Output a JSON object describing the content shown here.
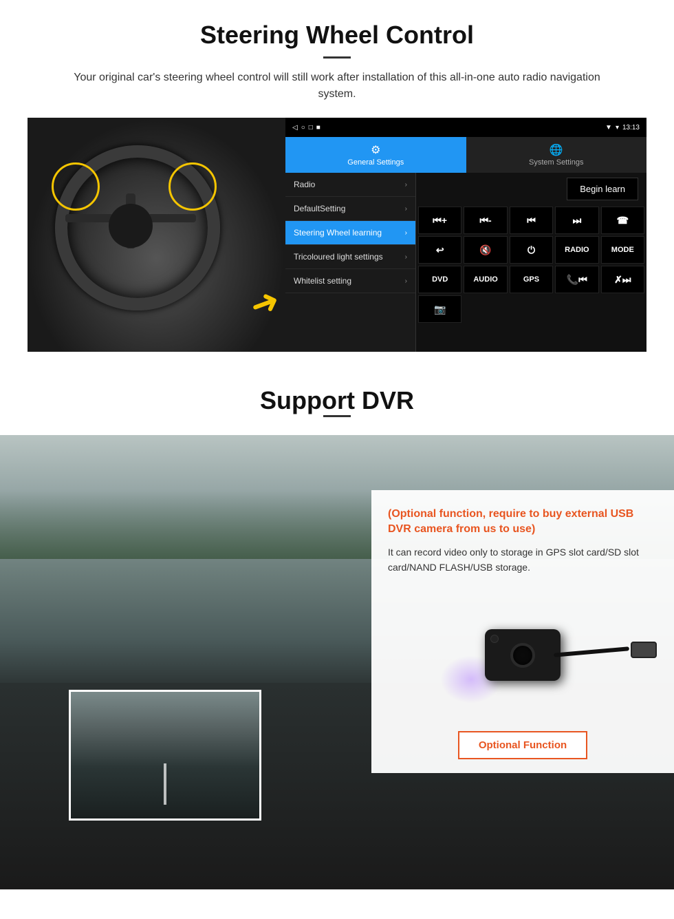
{
  "steering_section": {
    "title": "Steering Wheel Control",
    "subtitle": "Your original car's steering wheel control will still work after installation of this all-in-one auto radio navigation system.",
    "status_bar": {
      "time": "13:13",
      "signal": "▼",
      "wifi": "▾"
    },
    "nav_items": [
      "◁",
      "○",
      "□",
      "■"
    ],
    "tabs": {
      "general": {
        "icon": "⚙",
        "label": "General Settings"
      },
      "system": {
        "icon": "🌐",
        "label": "System Settings"
      }
    },
    "menu_items": [
      {
        "label": "Radio",
        "active": false
      },
      {
        "label": "DefaultSetting",
        "active": false
      },
      {
        "label": "Steering Wheel learning",
        "active": true
      },
      {
        "label": "Tricoloured light settings",
        "active": false
      },
      {
        "label": "Whitelist setting",
        "active": false
      }
    ],
    "begin_learn_label": "Begin learn",
    "control_buttons": [
      "⏮+",
      "⏮-",
      "⏮⏮",
      "⏭⏭",
      "☎",
      "↩",
      "🔇x",
      "⏻",
      "RADIO",
      "MODE",
      "DVD",
      "AUDIO",
      "GPS",
      "📞⏮",
      "✗⏭"
    ],
    "extra_btn": "📷"
  },
  "dvr_section": {
    "title": "Support DVR",
    "optional_heading": "(Optional function, require to buy external USB DVR camera from us to use)",
    "description": "It can record video only to storage in GPS slot card/SD slot card/NAND FLASH/USB storage.",
    "optional_function_label": "Optional Function",
    "optional_function_border_color": "#e85520"
  }
}
